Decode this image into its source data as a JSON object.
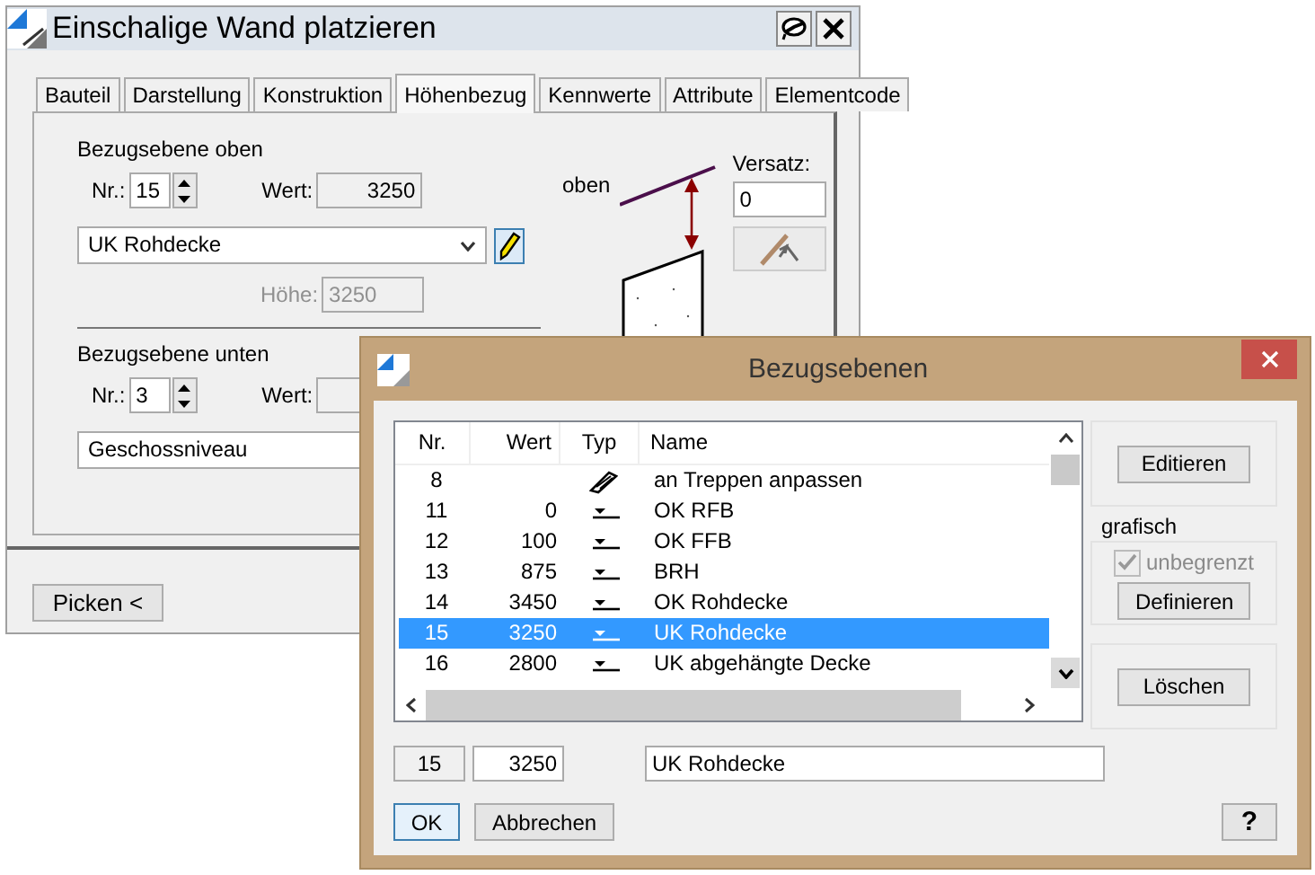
{
  "main_window": {
    "title": "Einschalige Wand platzieren",
    "tabs": [
      {
        "label": "Bauteil",
        "selected": false
      },
      {
        "label": "Darstellung",
        "selected": false
      },
      {
        "label": "Konstruktion",
        "selected": false
      },
      {
        "label": "Höhenbezug",
        "selected": true
      },
      {
        "label": "Kennwerte",
        "selected": false
      },
      {
        "label": "Attribute",
        "selected": false
      },
      {
        "label": "Elementcode",
        "selected": false
      }
    ],
    "upper": {
      "heading": "Bezugsebene oben",
      "nr_label": "Nr.:",
      "nr": "15",
      "wert_label": "Wert:",
      "wert": "3250",
      "name": "UK Rohdecke",
      "hoehe_label": "Höhe:",
      "hoehe": "3250"
    },
    "lower": {
      "heading": "Bezugsebene unten",
      "nr_label": "Nr.:",
      "nr": "3",
      "wert_label": "Wert:",
      "name": "Geschossniveau"
    },
    "diagram": {
      "label": "oben"
    },
    "offset": {
      "label": "Versatz:",
      "value": "0"
    },
    "pick_button": "Picken <"
  },
  "dialog": {
    "title": "Bezugsebenen",
    "columns": [
      "Nr.",
      "Wert",
      "Typ",
      "Name"
    ],
    "rows": [
      {
        "nr": "8",
        "wert": "",
        "kind": "stair",
        "name": "an Treppen anpassen",
        "selected": false
      },
      {
        "nr": "11",
        "wert": "0",
        "kind": "level",
        "name": "OK RFB",
        "selected": false
      },
      {
        "nr": "12",
        "wert": "100",
        "kind": "level",
        "name": "OK FFB",
        "selected": false
      },
      {
        "nr": "13",
        "wert": "875",
        "kind": "level",
        "name": "BRH",
        "selected": false
      },
      {
        "nr": "14",
        "wert": "3450",
        "kind": "level",
        "name": "OK Rohdecke",
        "selected": false
      },
      {
        "nr": "15",
        "wert": "3250",
        "kind": "level",
        "name": "UK Rohdecke",
        "selected": true
      },
      {
        "nr": "16",
        "wert": "2800",
        "kind": "level",
        "name": "UK abgehängte Decke",
        "selected": false
      }
    ],
    "edit_button": "Editieren",
    "group_label": "grafisch",
    "unlimited": {
      "label": "unbegrenzt",
      "checked": true,
      "disabled": true
    },
    "define_button": "Definieren",
    "delete_button": "Löschen",
    "selection": {
      "nr": "15",
      "wert": "3250",
      "name": "UK Rohdecke"
    },
    "ok_button": "OK",
    "cancel_button": "Abbrechen",
    "help_button": "?"
  }
}
